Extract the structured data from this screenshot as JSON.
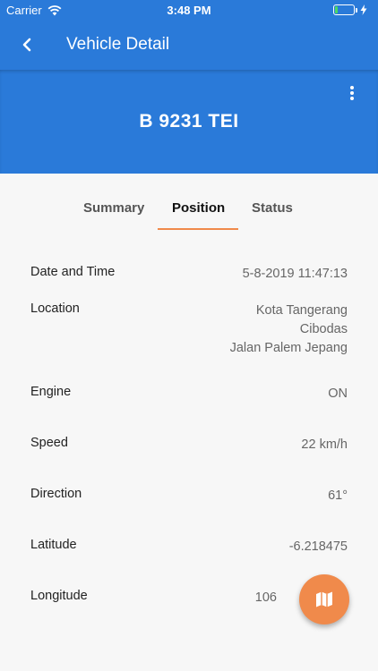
{
  "status_bar": {
    "carrier": "Carrier",
    "time": "3:48 PM",
    "battery_level": 0.15,
    "battery_color": "#4cd964"
  },
  "app_bar": {
    "title": "Vehicle Detail",
    "back_icon": "chevron-left-icon",
    "menu_icon": "more-vertical-icon"
  },
  "vehicle": {
    "plate": "B 9231 TEI"
  },
  "tabs": [
    {
      "label": "Summary",
      "active": false
    },
    {
      "label": "Position",
      "active": true
    },
    {
      "label": "Status",
      "active": false
    }
  ],
  "details": {
    "date_time": {
      "label": "Date and Time",
      "value": "5-8-2019 11:47:13"
    },
    "location": {
      "label": "Location",
      "lines": [
        "Kota Tangerang",
        "Cibodas",
        "Jalan Palem Jepang"
      ]
    },
    "engine": {
      "label": "Engine",
      "value": "ON"
    },
    "speed": {
      "label": "Speed",
      "value": "22 km/h"
    },
    "direction": {
      "label": "Direction",
      "value": "61°"
    },
    "latitude": {
      "label": "Latitude",
      "value": "-6.218475"
    },
    "longitude": {
      "label": "Longitude",
      "value": "106"
    }
  },
  "fab": {
    "icon": "map-icon"
  },
  "colors": {
    "primary": "#2a7ad9",
    "accent": "#f08a4b"
  }
}
